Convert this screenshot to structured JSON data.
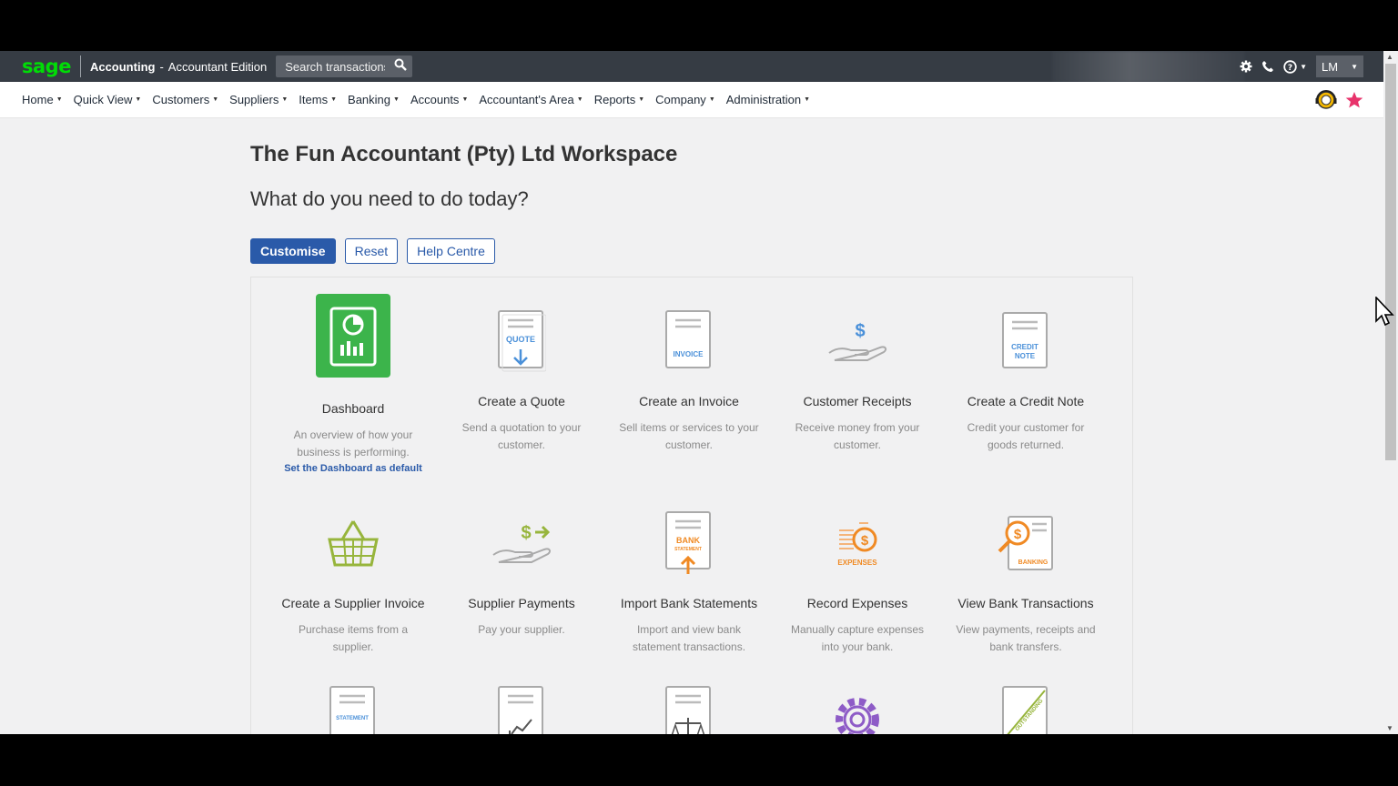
{
  "topbar": {
    "logo": "sage",
    "product": "Accounting",
    "dash": "-",
    "edition": "Accountant Edition",
    "search_placeholder": "Search transactions",
    "user_initials": "LM"
  },
  "nav": {
    "items": [
      {
        "label": "Home"
      },
      {
        "label": "Quick View"
      },
      {
        "label": "Customers"
      },
      {
        "label": "Suppliers"
      },
      {
        "label": "Items"
      },
      {
        "label": "Banking"
      },
      {
        "label": "Accounts"
      },
      {
        "label": "Accountant's Area"
      },
      {
        "label": "Reports"
      },
      {
        "label": "Company"
      },
      {
        "label": "Administration"
      }
    ]
  },
  "main": {
    "title": "The Fun Accountant (Pty) Ltd Workspace",
    "subtitle": "What do you need to do today?",
    "buttons": {
      "customise": "Customise",
      "reset": "Reset",
      "help": "Help Centre"
    }
  },
  "tiles": [
    {
      "title": "Dashboard",
      "desc": "An overview of how your business is performing.",
      "link": "Set the Dashboard as default",
      "icon": "dashboard-icon"
    },
    {
      "title": "Create a Quote",
      "desc": "Send a quotation to your customer.",
      "icon_text": "QUOTE",
      "icon": "quote-icon"
    },
    {
      "title": "Create an Invoice",
      "desc": "Sell items or services to your customer.",
      "icon_text": "INVOICE",
      "icon": "invoice-icon"
    },
    {
      "title": "Customer Receipts",
      "desc": "Receive money from your customer.",
      "icon_text": "$",
      "icon": "receipt-hand-icon"
    },
    {
      "title": "Create a Credit Note",
      "desc": "Credit your customer for goods returned.",
      "icon_text": "CREDIT",
      "icon_text2": "NOTE",
      "icon": "credit-note-icon"
    },
    {
      "title": "Create a Supplier Invoice",
      "desc": "Purchase items from a supplier.",
      "icon": "basket-icon"
    },
    {
      "title": "Supplier Payments",
      "desc": "Pay your supplier.",
      "icon_text": "$",
      "icon": "payment-hand-icon"
    },
    {
      "title": "Import Bank Statements",
      "desc": "Import and view bank statement transactions.",
      "icon_text": "BANK",
      "icon_text2": "STATEMENT",
      "icon": "bank-statement-icon"
    },
    {
      "title": "Record Expenses",
      "desc": "Manually capture expenses into your bank.",
      "icon_text": "EXPENSES",
      "icon": "expenses-icon"
    },
    {
      "title": "View Bank Transactions",
      "desc": "View payments, receipts and bank transfers.",
      "icon_text": "BANKING",
      "icon": "banking-search-icon"
    },
    {
      "title": "",
      "desc": "",
      "icon_text": "STATEMENT",
      "icon": "statement-icon"
    },
    {
      "title": "",
      "desc": "",
      "icon": "report-chart-icon"
    },
    {
      "title": "",
      "desc": "",
      "icon": "balance-scale-icon"
    },
    {
      "title": "",
      "desc": "",
      "icon": "settings-gear-icon"
    },
    {
      "title": "",
      "desc": "",
      "icon_text": "OUTSTANDING",
      "icon": "outstanding-icon"
    }
  ],
  "colors": {
    "brand_green": "#00dc06",
    "topbar": "#363c44",
    "primary_blue": "#2a5aa9",
    "tile_green": "#3cb44b",
    "icon_blue": "#4a90d9",
    "icon_orange": "#f08a24",
    "icon_olive": "#97b53c",
    "icon_purple": "#8e5cc7",
    "star_pink": "#e8336b"
  }
}
